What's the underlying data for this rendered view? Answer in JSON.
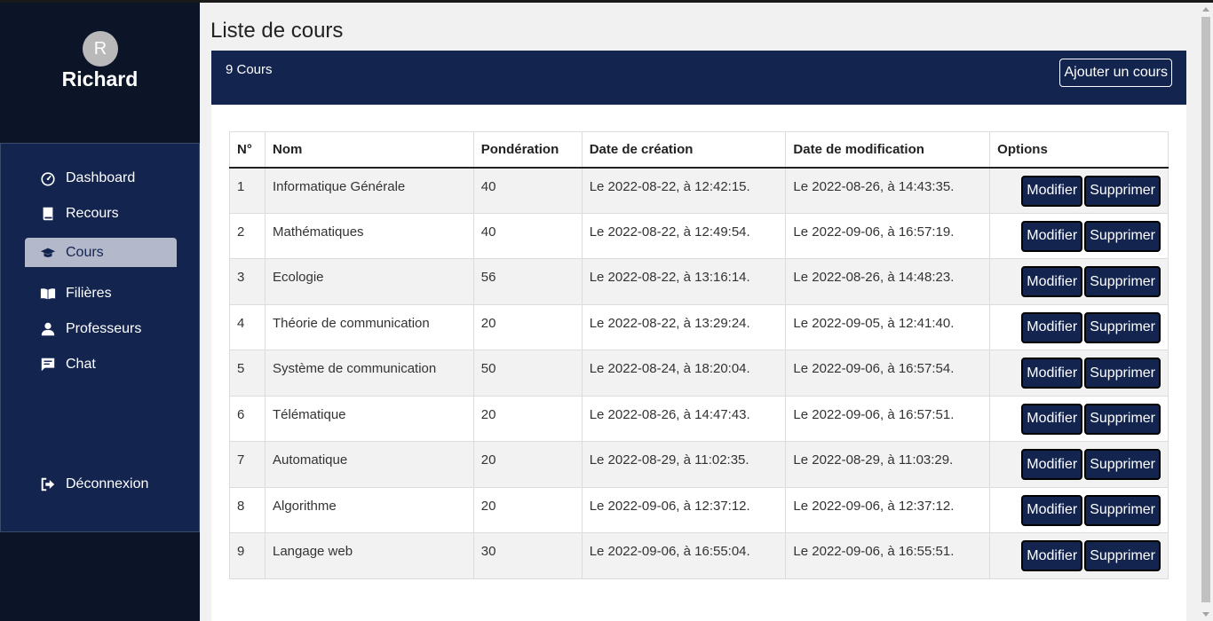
{
  "user": {
    "initial": "R",
    "name": "Richard"
  },
  "nav": {
    "items": [
      {
        "label": "Dashboard",
        "icon": "dashboard-icon"
      },
      {
        "label": "Recours",
        "icon": "book-icon"
      },
      {
        "label": "Cours",
        "icon": "graduation-cap-icon",
        "active": true
      },
      {
        "label": "Filières",
        "icon": "open-book-icon"
      },
      {
        "label": "Professeurs",
        "icon": "user-icon"
      },
      {
        "label": "Chat",
        "icon": "chat-icon"
      }
    ],
    "logout": "Déconnexion"
  },
  "page": {
    "title": "Liste de cours"
  },
  "card": {
    "count": "9 Cours",
    "add_label": "Ajouter un cours"
  },
  "table": {
    "headers": [
      "N°",
      "Nom",
      "Pondération",
      "Date de création",
      "Date de modification",
      "Options"
    ],
    "rows": [
      [
        "1",
        "Informatique Générale",
        "40",
        "Le 2022-08-22, à 12:42:15.",
        "Le 2022-08-26, à 14:43:35."
      ],
      [
        "2",
        "Mathématiques",
        "40",
        "Le 2022-08-22, à 12:49:54.",
        "Le 2022-09-06, à 16:57:19."
      ],
      [
        "3",
        "Ecologie",
        "56",
        "Le 2022-08-22, à 13:16:14.",
        "Le 2022-08-26, à 14:48:23."
      ],
      [
        "4",
        "Théorie de communication",
        "20",
        "Le 2022-08-22, à 13:29:24.",
        "Le 2022-09-05, à 12:41:40."
      ],
      [
        "5",
        "Système de communication",
        "50",
        "Le 2022-08-24, à 18:20:04.",
        "Le 2022-09-06, à 16:57:54."
      ],
      [
        "6",
        "Télématique",
        "20",
        "Le 2022-08-26, à 14:47:43.",
        "Le 2022-09-06, à 16:57:51."
      ],
      [
        "7",
        "Automatique",
        "20",
        "Le 2022-08-29, à 11:02:35.",
        "Le 2022-08-29, à 11:03:29."
      ],
      [
        "8",
        "Algorithme",
        "20",
        "Le 2022-09-06, à 12:37:12.",
        "Le 2022-09-06, à 12:37:12."
      ],
      [
        "9",
        "Langage web",
        "30",
        "Le 2022-09-06, à 16:55:04.",
        "Le 2022-09-06, à 16:55:51."
      ]
    ],
    "modify_label": "Modifier",
    "delete_label": "Supprimer"
  },
  "colors": {
    "sidebar_bg": "#0c1528",
    "nav_bg": "#13244f",
    "active_bg": "#b3b8ca",
    "button_bg": "#13244f"
  }
}
